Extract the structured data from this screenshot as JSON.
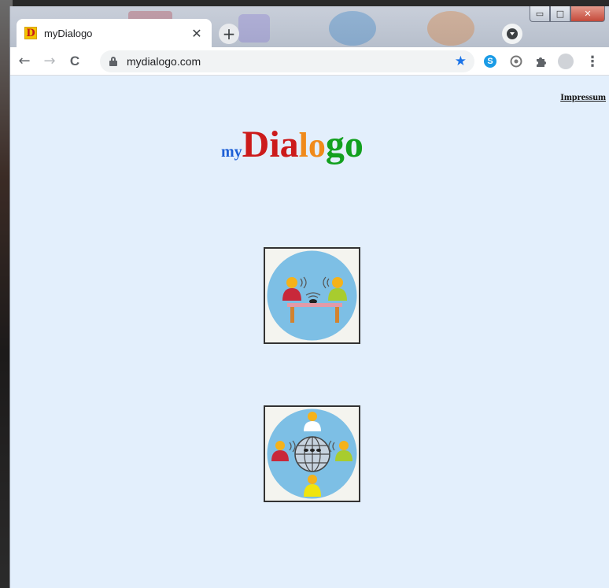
{
  "browser": {
    "tab": {
      "title": "myDialogo",
      "favicon_letter": "D",
      "close": "✕"
    },
    "new_tab": "+",
    "url": "mydialogo.com",
    "nav": {
      "back": "←",
      "forward": "→",
      "reload": "C"
    },
    "bookmark_icon": "★",
    "ext_skype": "S",
    "menu": "⋮",
    "window_controls": {
      "minimize": "▭",
      "maximize": "□",
      "close": "✕"
    }
  },
  "page": {
    "impressum_link": "Impressum",
    "logo": {
      "my": "my",
      "dia": "Dia",
      "lo": "lo",
      "go": "go"
    },
    "tiles": [
      {
        "name": "table-dialog"
      },
      {
        "name": "world-dialog"
      }
    ]
  },
  "colors": {
    "page_bg": "#e3effc",
    "logo_my": "#1d5fd6",
    "logo_dia": "#cc1b1b",
    "logo_lo": "#f08a1a",
    "logo_go": "#12a01e"
  }
}
